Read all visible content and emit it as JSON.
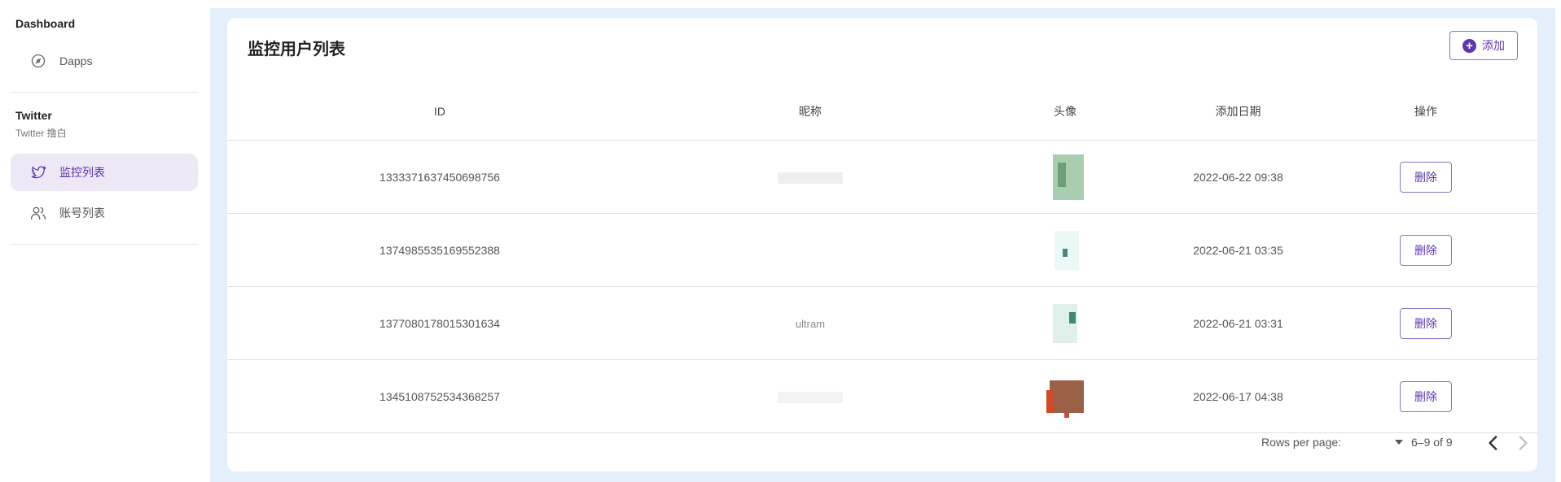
{
  "sidebar": {
    "section1": {
      "title": "Dashboard",
      "items": [
        {
          "label": "Dapps",
          "icon": "dashboard-gauge-icon"
        }
      ]
    },
    "section2": {
      "title": "Twitter",
      "subtitle": "Twitter 撸白",
      "items": [
        {
          "label": "监控列表",
          "icon": "twitter-bird-icon",
          "active": true
        },
        {
          "label": "账号列表",
          "icon": "users-icon",
          "active": false
        }
      ]
    }
  },
  "main": {
    "title": "监控用户列表",
    "add_label": "添加",
    "columns": [
      "ID",
      "昵称",
      "头像",
      "添加日期",
      "操作"
    ],
    "rows": [
      {
        "id": "1333371637450698756",
        "nickname": "",
        "date": "2022-06-22 09:38",
        "action": "删除"
      },
      {
        "id": "1374985535169552388",
        "nickname": "",
        "date": "2022-06-21 03:35",
        "action": "删除"
      },
      {
        "id": "1377080178015301634",
        "nickname": "ultram",
        "date": "2022-06-21 03:31",
        "action": "删除"
      },
      {
        "id": "1345108752534368257",
        "nickname": "",
        "date": "2022-06-17 04:38",
        "action": "删除"
      }
    ],
    "pagination": {
      "rows_per_page_label": "Rows per page:",
      "range": "6–9 of 9"
    }
  },
  "colors": {
    "accent": "#5e35b1",
    "accent_bg": "#ede7f6",
    "main_bg": "#e3effb"
  }
}
